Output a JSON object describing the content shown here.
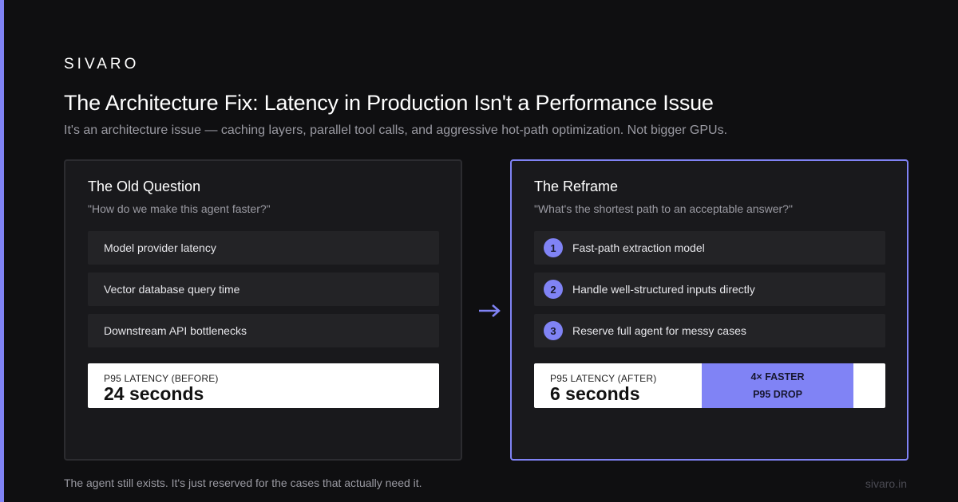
{
  "brand": "SIVARO",
  "title": "The Architecture Fix: Latency in Production Isn't a Performance Issue",
  "subtitle": "It's an architecture issue — caching layers, parallel tool calls, and aggressive hot-path optimization. Not bigger GPUs.",
  "old": {
    "title": "The Old Question",
    "question": "\"How do we make this agent faster?\"",
    "items": [
      "Model provider latency",
      "Vector database query time",
      "Downstream API bottlenecks"
    ],
    "metric_label": "P95 LATENCY (BEFORE)",
    "metric_value": "24 seconds"
  },
  "new": {
    "title": "The Reframe",
    "question": "\"What's the shortest path to an acceptable answer?\"",
    "items": [
      {
        "num": "1",
        "label": "Fast-path extraction model"
      },
      {
        "num": "2",
        "label": "Handle well-structured inputs directly"
      },
      {
        "num": "3",
        "label": "Reserve full agent for messy cases"
      }
    ],
    "metric_label": "P95 LATENCY (AFTER)",
    "metric_value": "6 seconds",
    "badge_line1": "4× FASTER",
    "badge_line2": "P95 DROP"
  },
  "arrow_icon": "arrow-right-icon",
  "footer_note": "The agent still exists. It's just reserved for the cases that actually need it.",
  "footer_site": "sivaro.in",
  "colors": {
    "background": "#0f0f11",
    "accent": "#8083f5",
    "card": "#19191c",
    "item": "#232326"
  }
}
